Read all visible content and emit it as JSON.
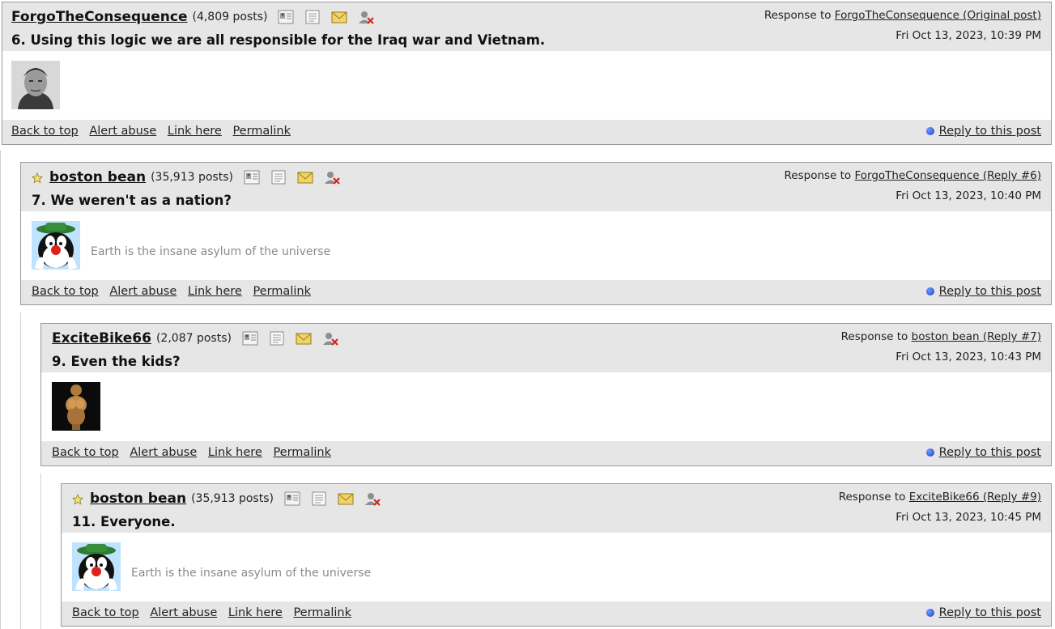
{
  "posts": [
    {
      "author": "ForgoTheConsequence",
      "post_count": "(4,809 posts)",
      "starred": false,
      "subject": "6. Using this logic we are all responsible for the Iraq war and Vietnam.",
      "response_prefix": "Response to",
      "response_link": "ForgoTheConsequence (Original post)",
      "date": "Fri Oct 13, 2023, 10:39 PM",
      "avatar": "grayscale-portrait-avatar",
      "signature": "",
      "footer": {
        "back_to_top": "Back to top",
        "alert_abuse": "Alert abuse",
        "link_here": "Link here",
        "permalink": "Permalink",
        "reply": "Reply to this post"
      }
    },
    {
      "author": "boston bean",
      "post_count": "(35,913 posts)",
      "starred": true,
      "subject": "7. We weren't as a nation?",
      "response_prefix": "Response to",
      "response_link": "ForgoTheConsequence (Reply #6)",
      "date": "Fri Oct 13, 2023, 10:40 PM",
      "avatar": "cartoon-cat-avatar",
      "signature": "Earth is the insane asylum of the universe",
      "footer": {
        "back_to_top": "Back to top",
        "alert_abuse": "Alert abuse",
        "link_here": "Link here",
        "permalink": "Permalink",
        "reply": "Reply to this post"
      }
    },
    {
      "author": "ExciteBike66",
      "post_count": "(2,087 posts)",
      "starred": false,
      "subject": "9. Even the kids?",
      "response_prefix": "Response to",
      "response_link": "boston bean (Reply #7)",
      "date": "Fri Oct 13, 2023, 10:43 PM",
      "avatar": "statue-figurine-avatar",
      "signature": "",
      "footer": {
        "back_to_top": "Back to top",
        "alert_abuse": "Alert abuse",
        "link_here": "Link here",
        "permalink": "Permalink",
        "reply": "Reply to this post"
      }
    },
    {
      "author": "boston bean",
      "post_count": "(35,913 posts)",
      "starred": true,
      "subject": "11. Everyone.",
      "response_prefix": "Response to",
      "response_link": "ExciteBike66 (Reply #9)",
      "date": "Fri Oct 13, 2023, 10:45 PM",
      "avatar": "cartoon-cat-avatar",
      "signature": "Earth is the insane asylum of the universe",
      "footer": {
        "back_to_top": "Back to top",
        "alert_abuse": "Alert abuse",
        "link_here": "Link here",
        "permalink": "Permalink",
        "reply": "Reply to this post"
      }
    }
  ],
  "colors": {
    "header_bg": "#e6e6e6",
    "border": "#9a9a9a",
    "signature": "#8a8a8a",
    "reply_dot": "#1b3fbf"
  }
}
